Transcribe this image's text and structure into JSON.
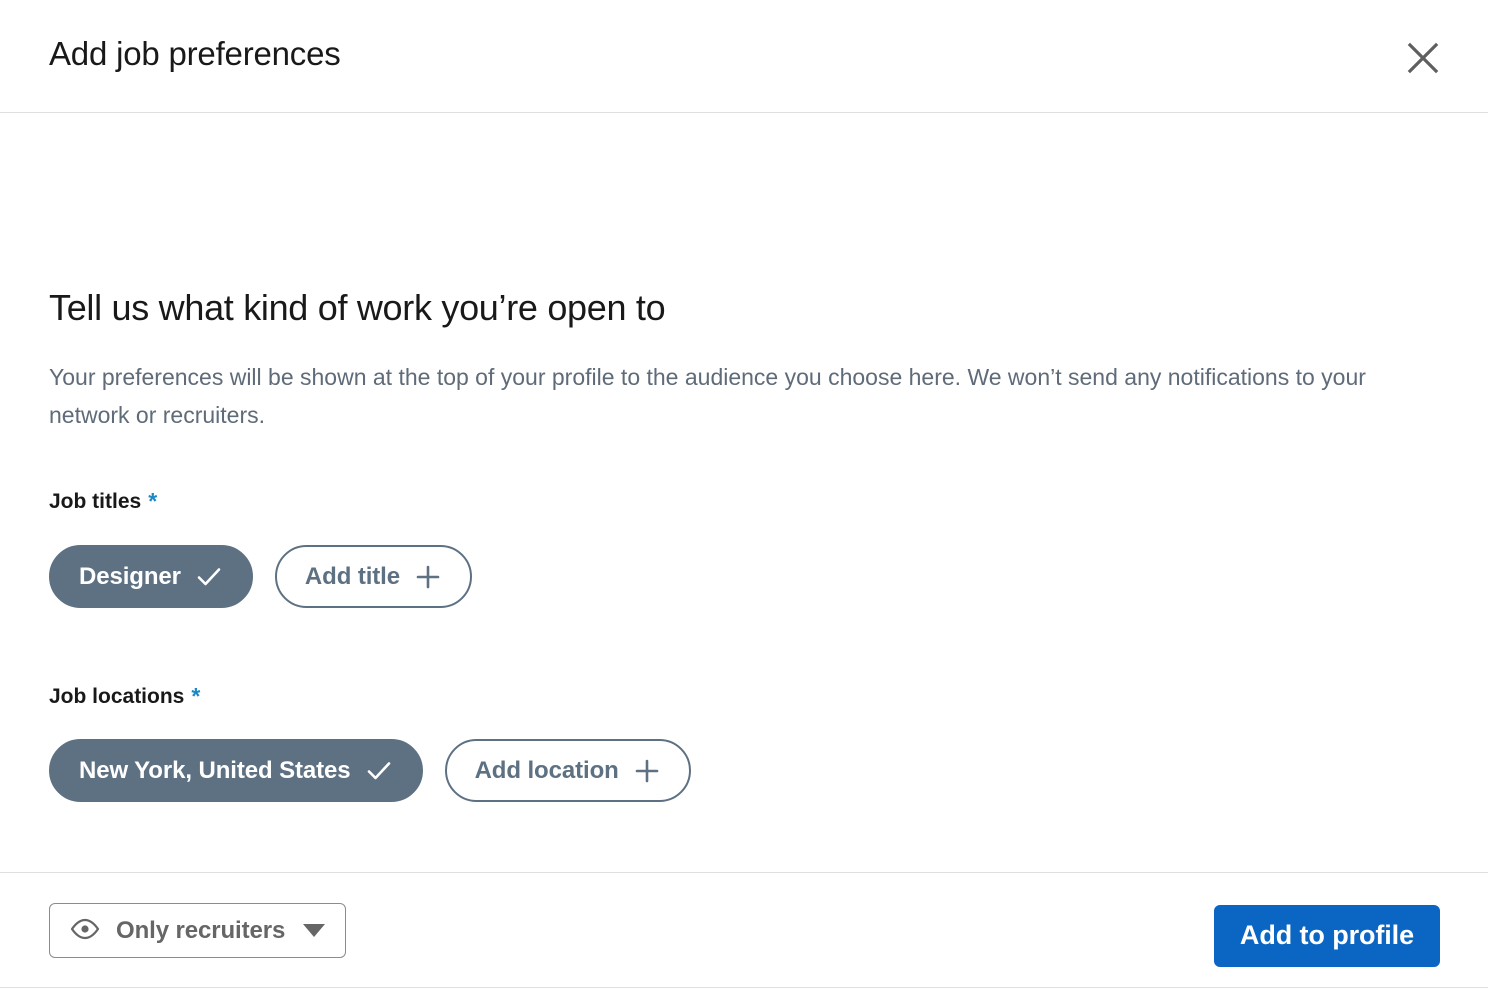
{
  "header": {
    "title": "Add job preferences",
    "close_icon": "close-icon"
  },
  "intro": {
    "heading": "Tell us what kind of work you’re open to",
    "description": "Your preferences will be shown at the top of your profile to the audience you choose here. We won’t send any notifications to your network or recruiters."
  },
  "fields": {
    "job_titles": {
      "label": "Job titles",
      "required_marker": "*",
      "selected": [
        {
          "label": "Designer",
          "state_icon": "check-icon"
        }
      ],
      "add_button": {
        "label": "Add title",
        "icon": "plus-icon"
      }
    },
    "job_locations": {
      "label": "Job locations",
      "required_marker": "*",
      "selected": [
        {
          "label": "New York, United States",
          "state_icon": "check-icon"
        }
      ],
      "add_button": {
        "label": "Add location",
        "icon": "plus-icon"
      }
    }
  },
  "visibility": {
    "icon": "eye-icon",
    "selected_option": "Only recruiters",
    "caret_icon": "chevron-down-icon"
  },
  "footer": {
    "primary_action": "Add to profile"
  },
  "colors": {
    "accent_blue": "#0a66c2",
    "required_star": "#1e87c4",
    "pill_slate": "#5e7183",
    "divider": "#e0e0e0",
    "body_text": "#5f6b78",
    "title_text": "#191919"
  }
}
